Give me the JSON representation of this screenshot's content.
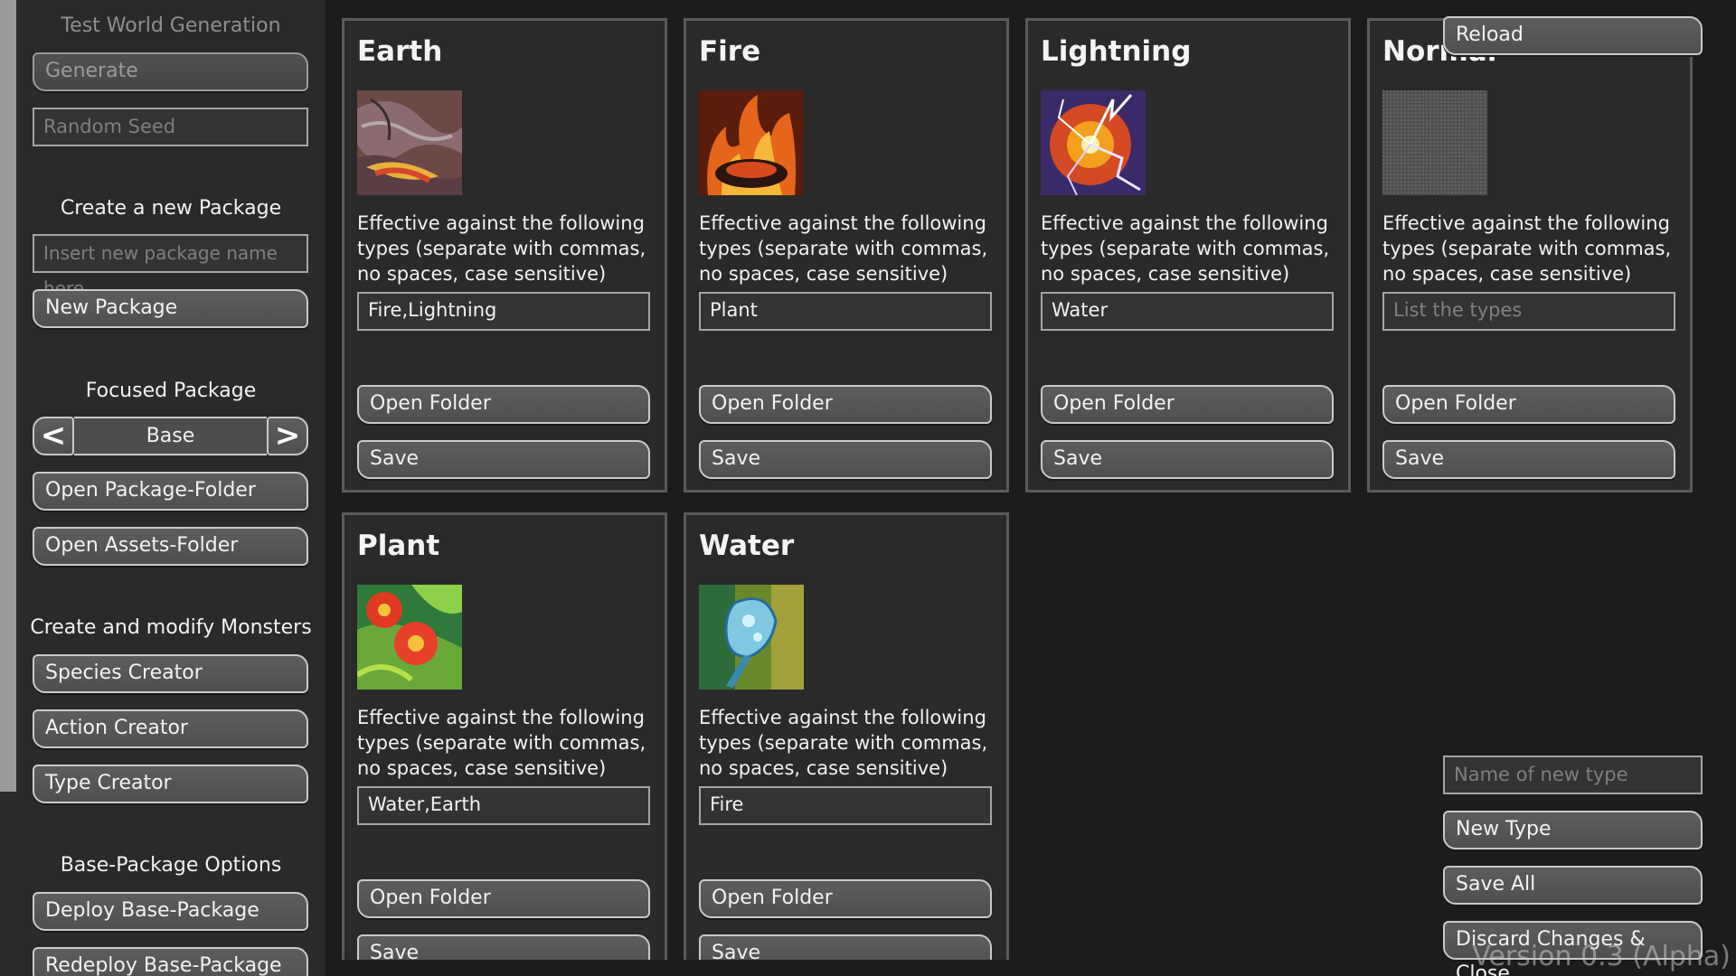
{
  "sidebar": {
    "title": "Test World Generation",
    "generate_label": "Generate",
    "seed_placeholder": "Random Seed",
    "create_package_title": "Create a new Package",
    "package_name_placeholder": "Insert new package name here",
    "new_package_label": "New Package",
    "focused_package_title": "Focused Package",
    "focused_package_value": "Base",
    "open_package_folder_label": "Open Package-Folder",
    "open_assets_folder_label": "Open Assets-Folder",
    "monsters_title": "Create and modify Monsters",
    "species_creator_label": "Species Creator",
    "action_creator_label": "Action Creator",
    "type_creator_label": "Type Creator",
    "base_options_title": "Base-Package Options",
    "deploy_label": "Deploy Base-Package",
    "redeploy_label": "Redeploy Base-Package"
  },
  "card_common": {
    "description": "Effective against the following types (separate with commas, no spaces, case sensitive)",
    "open_folder_label": "Open Folder",
    "save_label": "Save",
    "input_placeholder": "List the types"
  },
  "cards": [
    {
      "name": "Earth",
      "value": "Fire,Lightning",
      "image_icon": "earth-texture-icon"
    },
    {
      "name": "Fire",
      "value": "Plant",
      "image_icon": "fire-texture-icon"
    },
    {
      "name": "Lightning",
      "value": "Water",
      "image_icon": "lightning-texture-icon"
    },
    {
      "name": "Normal",
      "value": "",
      "image_icon": "normal-texture-icon"
    },
    {
      "name": "Plant",
      "value": "Water,Earth",
      "image_icon": "plant-texture-icon"
    },
    {
      "name": "Water",
      "value": "Fire",
      "image_icon": "water-texture-icon"
    }
  ],
  "right_panel": {
    "reload_label": "Reload",
    "new_type_placeholder": "Name of new type",
    "new_type_label": "New Type",
    "save_all_label": "Save All",
    "discard_label": "Discard Changes & Close"
  },
  "version": "Version 0.3 (Alpha)",
  "colors": {
    "background": "#1c1c1c",
    "panel": "#2a2a2a",
    "button": "#555555",
    "border": "#c9c9c9"
  }
}
